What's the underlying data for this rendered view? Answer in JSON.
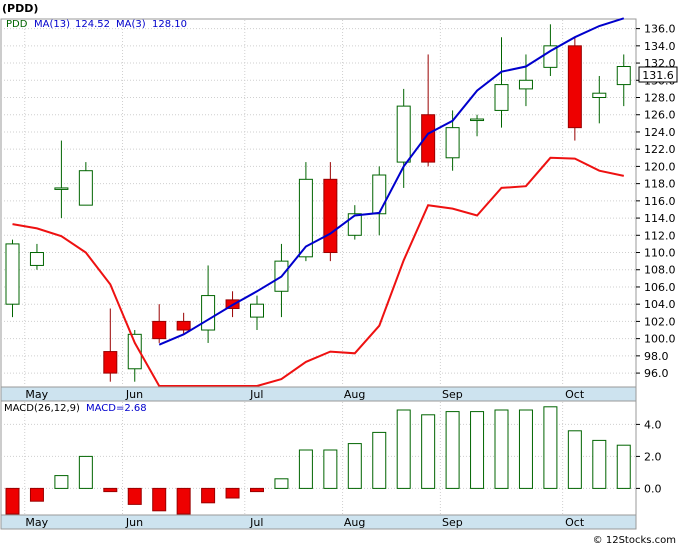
{
  "chart_data": [
    {
      "type": "candlestick",
      "ticker_label": "(PDD)",
      "legend": [
        {
          "label": "PDD",
          "value": "",
          "color": "#006400"
        },
        {
          "label": "MA(13)",
          "value": "124.52",
          "color": "#0000cc"
        },
        {
          "label": "MA(3)",
          "value": "128.10",
          "color": "#0000cc"
        }
      ],
      "last_price_label": "131.6",
      "ylim": [
        94.5,
        137
      ],
      "y_ticks": [
        "96.0",
        "98.0",
        "100.0",
        "102.0",
        "104.0",
        "106.0",
        "108.0",
        "110.0",
        "112.0",
        "114.0",
        "116.0",
        "118.0",
        "120.0",
        "122.0",
        "124.0",
        "126.0",
        "128.0",
        "130.0",
        "132.0",
        "134.0",
        "136.0"
      ],
      "x_month_labels": [
        {
          "label": "May",
          "index": 1
        },
        {
          "label": "Jun",
          "index": 5
        },
        {
          "label": "Jul",
          "index": 10
        },
        {
          "label": "Aug",
          "index": 14
        },
        {
          "label": "Sep",
          "index": 18
        },
        {
          "label": "Oct",
          "index": 23
        }
      ],
      "candles": [
        {
          "o": 104.0,
          "h": 111.5,
          "l": 102.5,
          "c": 111.0
        },
        {
          "o": 108.5,
          "h": 111.0,
          "l": 108.0,
          "c": 110.0
        },
        {
          "o": 117.5,
          "h": 123.0,
          "l": 114.0,
          "c": 117.5
        },
        {
          "o": 115.5,
          "h": 120.5,
          "l": 115.5,
          "c": 119.5
        },
        {
          "o": 98.5,
          "h": 103.5,
          "l": 95.0,
          "c": 96.0
        },
        {
          "o": 96.5,
          "h": 101.0,
          "l": 95.0,
          "c": 100.5
        },
        {
          "o": 102.0,
          "h": 104.0,
          "l": 99.5,
          "c": 100.0
        },
        {
          "o": 102.0,
          "h": 103.0,
          "l": 100.5,
          "c": 101.0
        },
        {
          "o": 101.0,
          "h": 108.5,
          "l": 99.5,
          "c": 105.0
        },
        {
          "o": 104.5,
          "h": 105.5,
          "l": 102.5,
          "c": 103.5
        },
        {
          "o": 102.5,
          "h": 105.0,
          "l": 101.0,
          "c": 104.0
        },
        {
          "o": 105.5,
          "h": 111.0,
          "l": 102.5,
          "c": 109.0
        },
        {
          "o": 109.5,
          "h": 120.5,
          "l": 109.0,
          "c": 118.5
        },
        {
          "o": 118.5,
          "h": 120.5,
          "l": 109.0,
          "c": 110.0
        },
        {
          "o": 112.0,
          "h": 115.5,
          "l": 111.5,
          "c": 114.5
        },
        {
          "o": 114.5,
          "h": 120.0,
          "l": 112.0,
          "c": 119.0
        },
        {
          "o": 120.5,
          "h": 129.0,
          "l": 117.5,
          "c": 127.0
        },
        {
          "o": 126.0,
          "h": 133.0,
          "l": 120.0,
          "c": 120.5
        },
        {
          "o": 121.0,
          "h": 126.5,
          "l": 119.5,
          "c": 124.5
        },
        {
          "o": 125.5,
          "h": 126.0,
          "l": 123.5,
          "c": 125.5
        },
        {
          "o": 126.5,
          "h": 135.0,
          "l": 124.5,
          "c": 129.5
        },
        {
          "o": 129.0,
          "h": 133.0,
          "l": 127.0,
          "c": 130.0
        },
        {
          "o": 131.5,
          "h": 136.5,
          "l": 130.5,
          "c": 134.0
        },
        {
          "o": 134.0,
          "h": 135.0,
          "l": 123.0,
          "c": 124.5
        },
        {
          "o": 128.0,
          "h": 130.5,
          "l": 125.0,
          "c": 128.5
        },
        {
          "o": 129.5,
          "h": 133.0,
          "l": 127.0,
          "c": 131.6
        }
      ],
      "series": [
        {
          "name": "MA(13)",
          "color": "#0000cc",
          "values": [
            null,
            null,
            null,
            null,
            null,
            null,
            99.3,
            100.5,
            102.2,
            103.9,
            105.5,
            107.2,
            110.7,
            112.2,
            114.3,
            114.6,
            120.0,
            123.8,
            125.3,
            128.8,
            131.0,
            131.6,
            133.4,
            135.0,
            136.3,
            137.2
          ]
        },
        {
          "name": "MA(3)",
          "color": "#ee1111",
          "values": [
            113.3,
            112.8,
            111.9,
            110.0,
            106.3,
            99.5,
            92.0,
            89.0,
            91.0,
            93.4,
            93.7,
            95.3,
            97.3,
            98.5,
            98.3,
            101.5,
            109.1,
            115.5,
            115.1,
            114.3,
            117.5,
            117.7,
            121.0,
            120.9,
            119.5,
            118.9
          ]
        }
      ],
      "macd": {
        "label": "MACD(26,12,9)",
        "value_label": "MACD=2.68",
        "ylim": [
          -1.6,
          5.4
        ],
        "y_ticks": [
          "0.0",
          "2.0",
          "4.0"
        ],
        "values": [
          -1.8,
          -0.8,
          0.8,
          2.0,
          -0.2,
          -1.0,
          -1.4,
          -1.8,
          -0.9,
          -0.6,
          -0.2,
          0.6,
          2.4,
          2.4,
          2.8,
          3.5,
          4.9,
          4.6,
          4.8,
          4.8,
          4.9,
          4.9,
          5.1,
          3.6,
          3.0,
          2.7
        ]
      },
      "watermark": "© 12Stocks.com"
    }
  ]
}
